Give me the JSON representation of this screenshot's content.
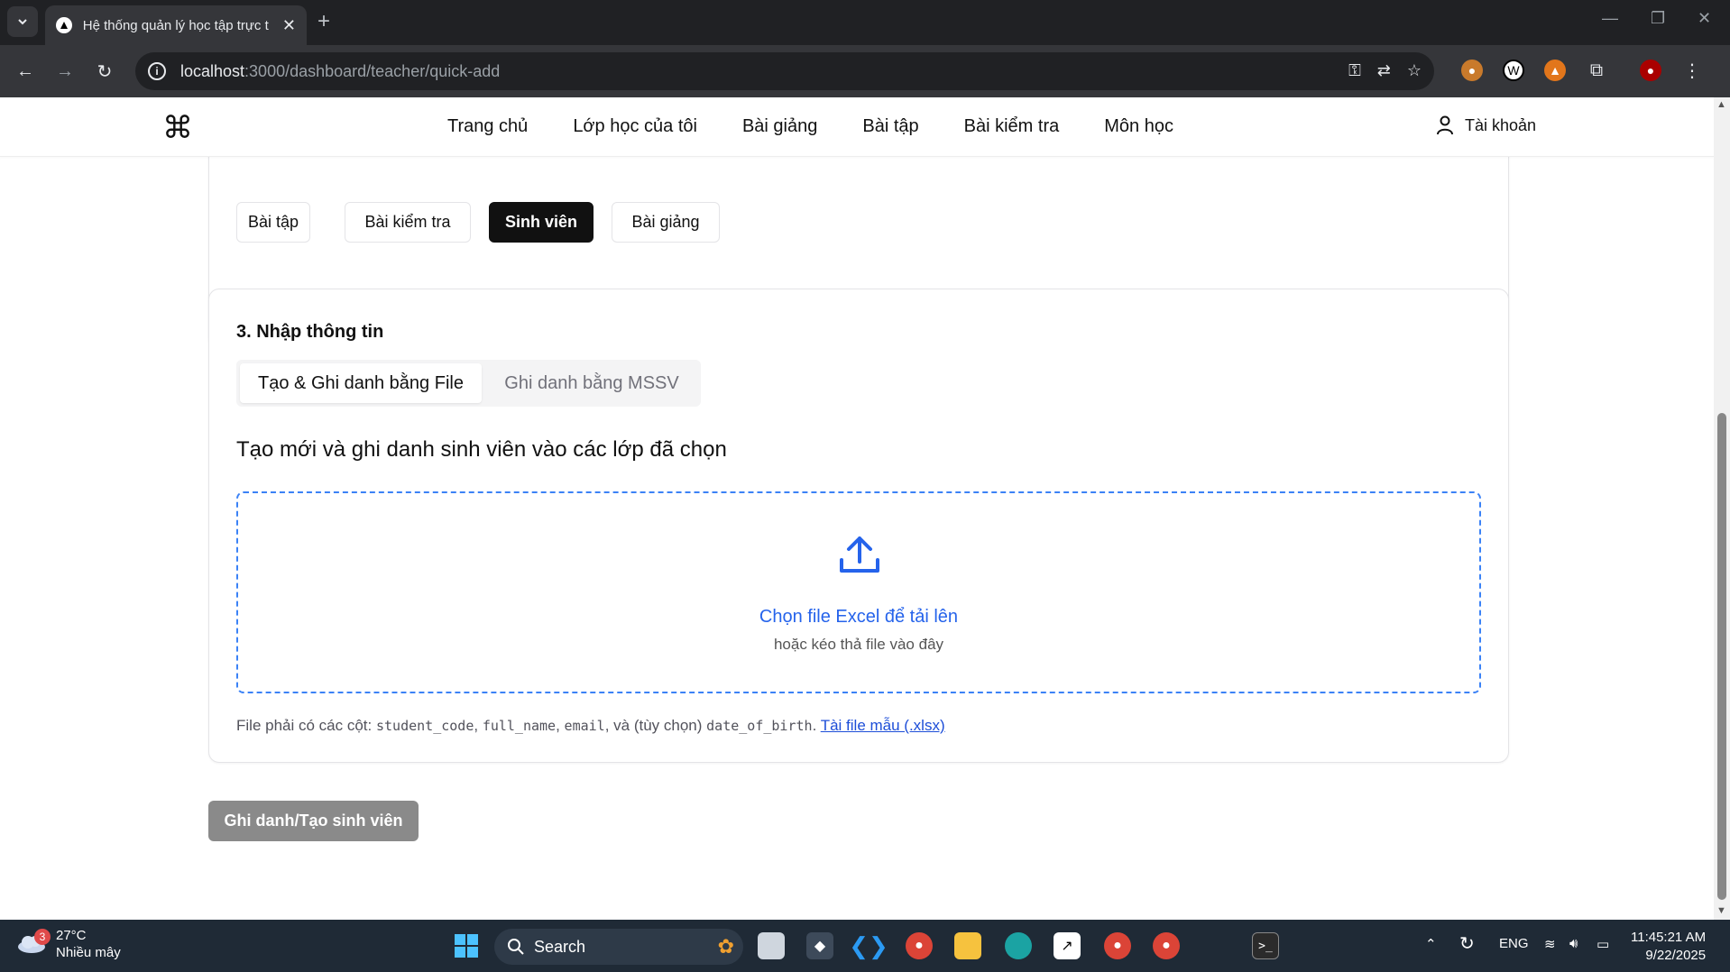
{
  "browser": {
    "tab_title": "Hệ thống quản lý học tập trực t",
    "url_host": "localhost",
    "url_path": ":3000/dashboard/teacher/quick-add"
  },
  "header": {
    "nav": [
      "Trang chủ",
      "Lớp học của tôi",
      "Bài giảng",
      "Bài tập",
      "Bài kiểm tra",
      "Môn học"
    ],
    "account": "Tài khoản"
  },
  "types": {
    "items": [
      "Bài tập",
      "Bài kiểm tra",
      "Sinh viên",
      "Bài giảng"
    ],
    "active": "Sinh viên"
  },
  "section": {
    "title": "3. Nhập thông tin",
    "tabs": [
      "Tạo & Ghi danh bằng File",
      "Ghi danh bằng MSSV"
    ],
    "subtitle": "Tạo mới và ghi danh sinh viên vào các lớp đã chọn",
    "dropzone_main": "Chọn file Excel để tải lên",
    "dropzone_sub": "hoặc kéo thả file vào đây",
    "note_prefix": "File phải có các cột:",
    "note_cols": [
      "student_code",
      "full_name",
      "email"
    ],
    "note_mid": ", và (tùy chọn)",
    "note_optional": "date_of_birth",
    "note_link": "Tài file mẫu (.xlsx)"
  },
  "submit": "Ghi danh/Tạo sinh viên",
  "taskbar": {
    "weather_badge": "3",
    "temperature": "27°C",
    "condition": "Nhiều mây",
    "search": "Search",
    "lang": "ENG",
    "time": "11:45:21 AM",
    "date": "9/22/2025"
  },
  "colors": {
    "accent": "#2563eb",
    "active_button": "#111111",
    "submit_disabled": "#8a8a8a"
  }
}
